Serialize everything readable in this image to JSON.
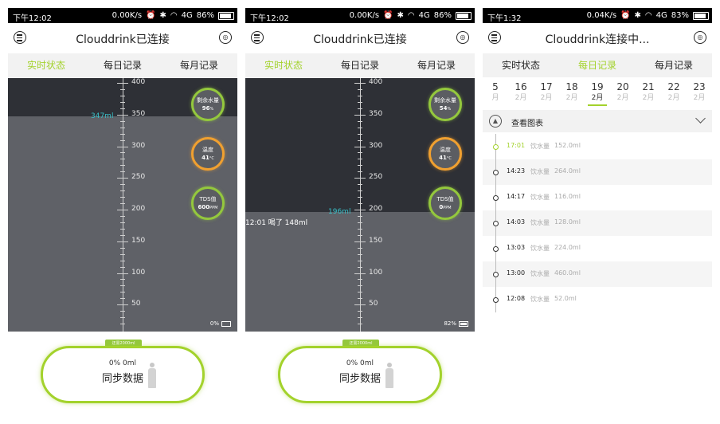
{
  "colors": {
    "accent": "#a3d22c",
    "water": "#5f6167",
    "empty": "#2e3036",
    "level_text": "#39c0c8",
    "orange": "#f0a030"
  },
  "icons": [
    "menu-icon",
    "cup-icon",
    "alarm-icon",
    "bluetooth-icon",
    "wifi-icon",
    "signal-icon",
    "battery-icon",
    "chart-icon",
    "chevron-down-icon",
    "person-icon"
  ],
  "tab_labels": [
    "实时状态",
    "每日记录",
    "每月记录"
  ],
  "scale_labels": [
    "400",
    "350",
    "300",
    "250",
    "200",
    "150",
    "100",
    "50"
  ],
  "screens": [
    {
      "status": {
        "time": "下午12:02",
        "speed": "0.00K/s",
        "network": "4G",
        "battery": "86%"
      },
      "title": "Clouddrink已连接",
      "active_tab": 0,
      "level_value": 347,
      "level_label": "347ml",
      "circles": [
        {
          "label": "剩余水量",
          "value": "96",
          "unit": "%"
        },
        {
          "label": "温度",
          "value": "41",
          "unit": "°C"
        },
        {
          "label": "TDS值",
          "value": "600",
          "unit": "PPM"
        }
      ],
      "cup_battery": "0%",
      "target": "还需2000ml",
      "progress": "0% 0ml",
      "sync_label": "同步数据"
    },
    {
      "status": {
        "time": "下午12:02",
        "speed": "0.00K/s",
        "network": "4G",
        "battery": "86%"
      },
      "title": "Clouddrink已连接",
      "active_tab": 0,
      "level_value": 196,
      "level_label": "196ml",
      "drink_note": "12:01 喝了 148ml",
      "circles": [
        {
          "label": "剩余水量",
          "value": "54",
          "unit": "%"
        },
        {
          "label": "温度",
          "value": "41",
          "unit": "°C"
        },
        {
          "label": "TDS值",
          "value": "0",
          "unit": "PPM"
        }
      ],
      "cup_battery": "82%",
      "target": "还需2000ml",
      "progress": "0% 0ml",
      "sync_label": "同步数据"
    },
    {
      "status": {
        "time": "下午1:32",
        "speed": "0.04K/s",
        "network": "4G",
        "battery": "83%"
      },
      "title": "Clouddrink连接中...",
      "active_tab": 1,
      "dates": [
        {
          "day": "5",
          "month": "月"
        },
        {
          "day": "16",
          "month": "2月"
        },
        {
          "day": "17",
          "month": "2月"
        },
        {
          "day": "18",
          "month": "2月"
        },
        {
          "day": "19",
          "month": "2月"
        },
        {
          "day": "20",
          "month": "2月"
        },
        {
          "day": "21",
          "month": "2月"
        },
        {
          "day": "22",
          "month": "2月"
        },
        {
          "day": "23",
          "month": "2月"
        }
      ],
      "selected_date": 4,
      "chart_label": "查看图表",
      "records": [
        {
          "time": "17:01",
          "label": "饮水量",
          "amount": "152.0ml"
        },
        {
          "time": "14:23",
          "label": "饮水量",
          "amount": "264.0ml"
        },
        {
          "time": "14:17",
          "label": "饮水量",
          "amount": "116.0ml"
        },
        {
          "time": "14:03",
          "label": "饮水量",
          "amount": "128.0ml"
        },
        {
          "time": "13:03",
          "label": "饮水量",
          "amount": "224.0ml"
        },
        {
          "time": "13:00",
          "label": "饮水量",
          "amount": "460.0ml"
        },
        {
          "time": "12:08",
          "label": "饮水量",
          "amount": "52.0ml"
        }
      ]
    }
  ]
}
